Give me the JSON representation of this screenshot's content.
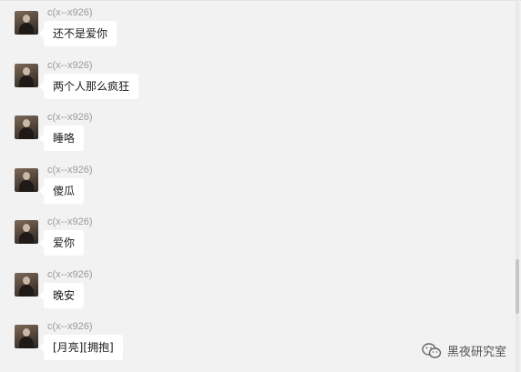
{
  "chat": {
    "messages": [
      {
        "sender": "c(x--x926)",
        "text": "还不是爱你"
      },
      {
        "sender": "c(x--x926)",
        "text": "两个人那么疯狂"
      },
      {
        "sender": "c(x--x926)",
        "text": "睡咯"
      },
      {
        "sender": "c(x--x926)",
        "text": "傻瓜"
      },
      {
        "sender": "c(x--x926)",
        "text": "爱你"
      },
      {
        "sender": "c(x--x926)",
        "text": "晚安"
      },
      {
        "sender": "c(x--x926)",
        "text": "[月亮][拥抱]"
      }
    ]
  },
  "watermark": {
    "text": "黑夜研究室",
    "icon": "wechat-icon"
  },
  "colors": {
    "background": "#f2f2f2",
    "bubble": "#ffffff",
    "sender": "#9a9a9a"
  }
}
